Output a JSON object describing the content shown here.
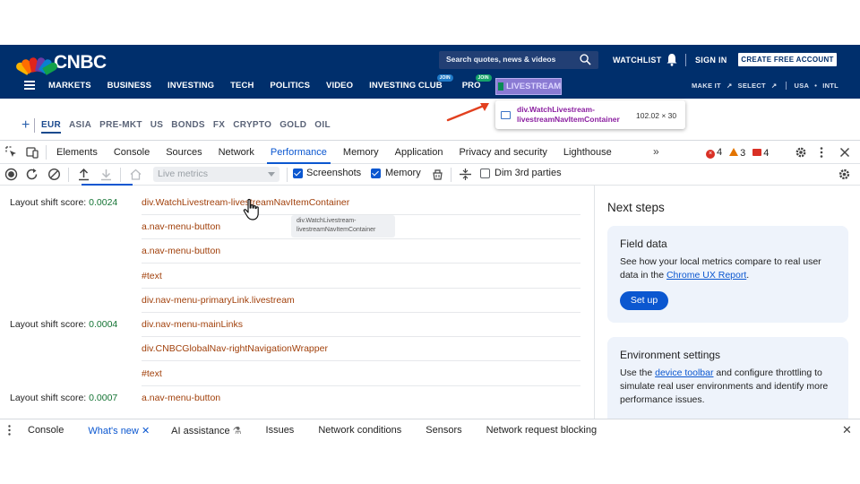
{
  "cnbc": {
    "logo": "CNBC",
    "search_placeholder": "Search quotes, news & videos",
    "watchlist": "WATCHLIST",
    "sign_in": "SIGN IN",
    "create_account": "CREATE FREE ACCOUNT",
    "nav": [
      {
        "label": "MARKETS"
      },
      {
        "label": "BUSINESS"
      },
      {
        "label": "INVESTING"
      },
      {
        "label": "TECH"
      },
      {
        "label": "POLITICS"
      },
      {
        "label": "VIDEO"
      },
      {
        "label": "INVESTING CLUB",
        "badge": "JOIN"
      },
      {
        "label": "PRO",
        "badge": "JOIN"
      }
    ],
    "livestream": "LIVESTREAM",
    "right_links": [
      "MAKE IT",
      "SELECT",
      "USA",
      "INTL"
    ],
    "currency_tabs": [
      "EUR",
      "ASIA",
      "PRE-MKT",
      "US",
      "BONDS",
      "FX",
      "CRYPTO",
      "GOLD",
      "OIL"
    ],
    "active_currency": "EUR",
    "inspect_tooltip": {
      "name": "div.WatchLivestream-livestreamNavItemContainer",
      "dims": "102.02 × 30"
    }
  },
  "devtools": {
    "tabs": [
      "Elements",
      "Console",
      "Sources",
      "Network",
      "Performance",
      "Memory",
      "Application",
      "Privacy and security",
      "Lighthouse"
    ],
    "active_tab": "Performance",
    "counts": {
      "errors": "4",
      "warnings": "3",
      "messages": "4"
    },
    "colors": {
      "accent": "#0b57d0",
      "node": "#a1400b",
      "score": "#137333"
    },
    "toolbar": {
      "live_metrics": "Live metrics",
      "screenshots": "Screenshots",
      "memory": "Memory",
      "dim_third": "Dim 3rd parties",
      "screenshots_checked": true,
      "memory_checked": true,
      "dim_third_checked": false
    },
    "shift_label": "Layout shift score:",
    "shifts": [
      {
        "score": "0.0024",
        "nodes": [
          "div.WatchLivestream-livestreamNavItemContainer",
          "a.nav-menu-button",
          "a.nav-menu-button",
          "#text",
          "div.nav-menu-primaryLink.livestream"
        ]
      },
      {
        "score": "0.0004",
        "nodes": [
          "div.nav-menu-mainLinks",
          "div.CNBCGlobalNav-rightNavigationWrapper",
          "#text"
        ]
      },
      {
        "score": "0.0007",
        "nodes": [
          "a.nav-menu-button"
        ]
      }
    ],
    "hover_tip": "div.WatchLivestream-livestreamNavItemContainer",
    "next_steps": {
      "title": "Next steps",
      "field_data": {
        "title": "Field data",
        "body_pre": "See how your local metrics compare to real user data in the ",
        "link": "Chrome UX Report",
        "body_post": ".",
        "button": "Set up"
      },
      "environment": {
        "title": "Environment settings",
        "body_pre": "Use the ",
        "link": "device toolbar",
        "body_post": " and configure throttling to simulate real user environments and identify more performance issues."
      }
    },
    "drawer": {
      "tabs": [
        "Console",
        "What's new",
        "AI assistance",
        "Issues",
        "Network conditions",
        "Sensors",
        "Network request blocking"
      ],
      "active": "What's new"
    }
  }
}
